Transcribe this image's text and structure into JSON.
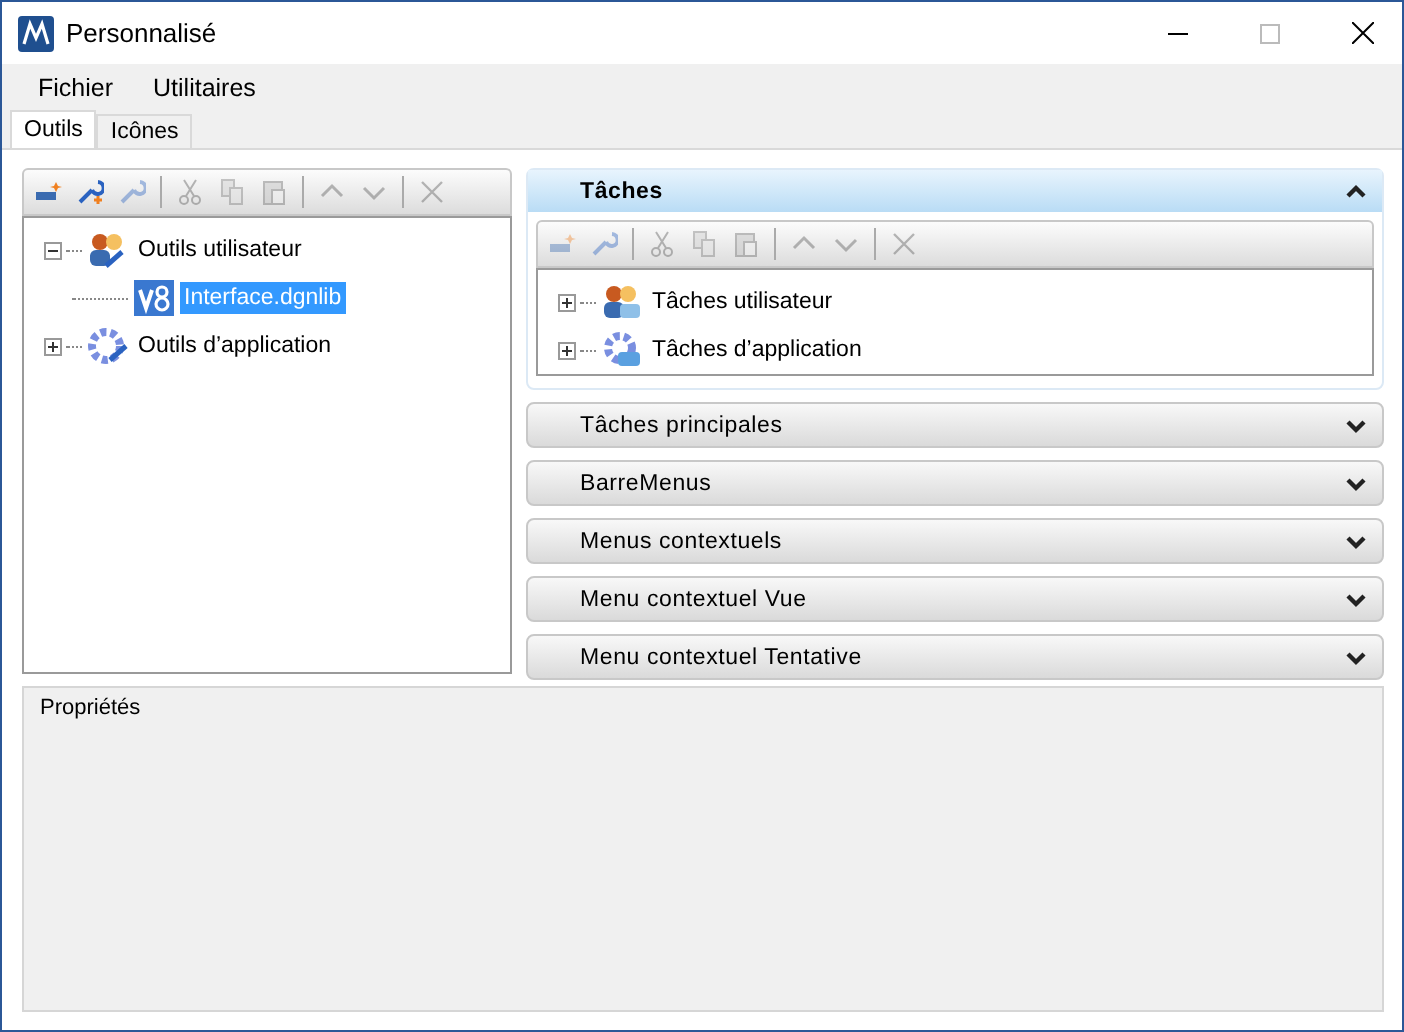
{
  "window": {
    "title": "Personnalisé"
  },
  "menu": [
    "Fichier",
    "Utilitaires"
  ],
  "tabs": [
    {
      "label": "Outils",
      "selected": true
    },
    {
      "label": "Icônes",
      "selected": false
    }
  ],
  "tools_toolbar": [
    {
      "kind": "new",
      "disabled": false
    },
    {
      "kind": "wrench-add",
      "disabled": false
    },
    {
      "kind": "wrench",
      "disabled": true
    },
    {
      "kind": "sep"
    },
    {
      "kind": "cut",
      "disabled": true
    },
    {
      "kind": "copy",
      "disabled": true
    },
    {
      "kind": "paste",
      "disabled": true
    },
    {
      "kind": "sep"
    },
    {
      "kind": "up",
      "disabled": true
    },
    {
      "kind": "down",
      "disabled": true
    },
    {
      "kind": "sep"
    },
    {
      "kind": "delete",
      "disabled": true
    }
  ],
  "tools_tree": [
    {
      "label": "Outils utilisateur",
      "kind": "users",
      "expanded": true,
      "selected": false,
      "children": [
        {
          "label": "Interface.dgnlib",
          "kind": "file",
          "selected": true
        }
      ]
    },
    {
      "label": "Outils d’application",
      "kind": "gear",
      "expanded": false,
      "selected": false
    }
  ],
  "sections": [
    {
      "title": "Tâches",
      "expanded": true,
      "toolbar": [
        {
          "kind": "new",
          "disabled": true
        },
        {
          "kind": "wrench",
          "disabled": true
        },
        {
          "kind": "sep"
        },
        {
          "kind": "cut",
          "disabled": true
        },
        {
          "kind": "copy",
          "disabled": true
        },
        {
          "kind": "paste",
          "disabled": true
        },
        {
          "kind": "sep"
        },
        {
          "kind": "up",
          "disabled": true
        },
        {
          "kind": "down",
          "disabled": true
        },
        {
          "kind": "sep"
        },
        {
          "kind": "delete",
          "disabled": true
        }
      ],
      "tree": [
        {
          "label": "Tâches utilisateur",
          "kind": "users",
          "expanded": false,
          "selected": false
        },
        {
          "label": "Tâches d’application",
          "kind": "gear",
          "expanded": false,
          "selected": false
        }
      ]
    },
    {
      "title": "Tâches principales",
      "expanded": false
    },
    {
      "title": "BarreMenus",
      "expanded": false
    },
    {
      "title": "Menus contextuels",
      "expanded": false
    },
    {
      "title": "Menu contextuel Vue",
      "expanded": false
    },
    {
      "title": "Menu contextuel Tentative",
      "expanded": false
    }
  ],
  "properties": {
    "title": "Propriétés"
  }
}
